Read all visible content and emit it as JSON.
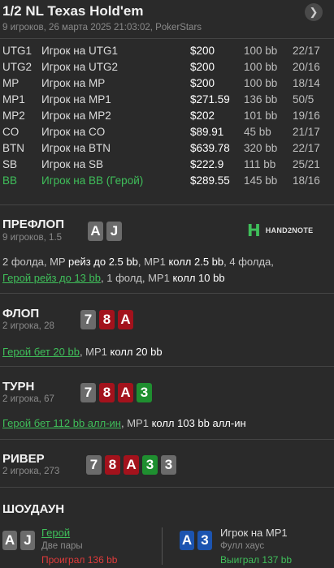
{
  "header": {
    "title": "1/2 NL Texas Hold'em",
    "subtitle": "9 игроков, 26 марта 2025 21:03:02, PokerStars",
    "nav_icon": "chevron-right-icon"
  },
  "players": [
    {
      "pos": "UTG1",
      "name": "Игрок на UTG1",
      "stack": "$200",
      "bb": "100 bb",
      "hands": "22/17"
    },
    {
      "pos": "UTG2",
      "name": "Игрок на UTG2",
      "stack": "$200",
      "bb": "100 bb",
      "hands": "20/16"
    },
    {
      "pos": "MP",
      "name": "Игрок на MP",
      "stack": "$200",
      "bb": "100 bb",
      "hands": "18/14"
    },
    {
      "pos": "MP1",
      "name": "Игрок на MP1",
      "stack": "$271.59",
      "bb": "136 bb",
      "hands": "50/5"
    },
    {
      "pos": "MP2",
      "name": "Игрок на MP2",
      "stack": "$202",
      "bb": "101 bb",
      "hands": "19/16"
    },
    {
      "pos": "CO",
      "name": "Игрок на CO",
      "stack": "$89.91",
      "bb": "45 bb",
      "hands": "21/17"
    },
    {
      "pos": "BTN",
      "name": "Игрок на BTN",
      "stack": "$639.78",
      "bb": "320 bb",
      "hands": "22/17"
    },
    {
      "pos": "SB",
      "name": "Игрок на SB",
      "stack": "$222.9",
      "bb": "111 bb",
      "hands": "25/21"
    },
    {
      "pos": "BB",
      "name": "Игрок на BB (Герой)",
      "stack": "$289.55",
      "bb": "145 bb",
      "hands": "18/16"
    }
  ],
  "logo": {
    "mark": "H",
    "text": "HAND2NOTE"
  },
  "preflop": {
    "title": "ПРЕФЛОП",
    "sub": "9 игроков, 1.5",
    "hero_cards": [
      "A",
      "J"
    ],
    "line1": {
      "a": "2 фолда, MP ",
      "b": "рейз до 2.5 bb",
      "c": ", MP1 ",
      "d": "колл 2.5 bb",
      "e": ", 4 фолда,"
    },
    "line2": {
      "a": "Герой рейз до 13 bb",
      "b": ", 1 фолд, MP1 ",
      "c": "колл 10 bb"
    }
  },
  "flop": {
    "title": "ФЛОП",
    "sub": "2 игрока, 28",
    "cards": [
      "7",
      "8",
      "A"
    ],
    "action": {
      "a": "Герой бет 20 bb",
      "b": ", MP1 ",
      "c": "колл 20 bb"
    }
  },
  "turn": {
    "title": "ТУРН",
    "sub": "2 игрока, 67",
    "cards": [
      "7",
      "8",
      "A",
      "3"
    ],
    "action": {
      "a": "Герой бет 112 bb алл-ин",
      "b": ", MP1 ",
      "c": "колл 103 bb алл-ин"
    }
  },
  "river": {
    "title": "РИВЕР",
    "sub": "2 игрока, 273",
    "cards": [
      "7",
      "8",
      "A",
      "3",
      "3"
    ]
  },
  "showdown": {
    "title": "ШОУДАУН",
    "hero": {
      "cards": [
        "A",
        "J"
      ],
      "name": "Герой",
      "combo": "Две пары",
      "result": "Проиграл 136 bb"
    },
    "villain": {
      "cards": [
        "A",
        "3"
      ],
      "name": "Игрок на MP1",
      "combo": "Фулл хаус",
      "result": "Выиграл 137 bb"
    }
  },
  "colors": {
    "hero_green": "#3fbf5a",
    "spade": "#6b6b6b",
    "heart": "#a3121c",
    "club": "#1f8f30",
    "diamond": "#1c54b0",
    "loss": "#e03b3b"
  }
}
